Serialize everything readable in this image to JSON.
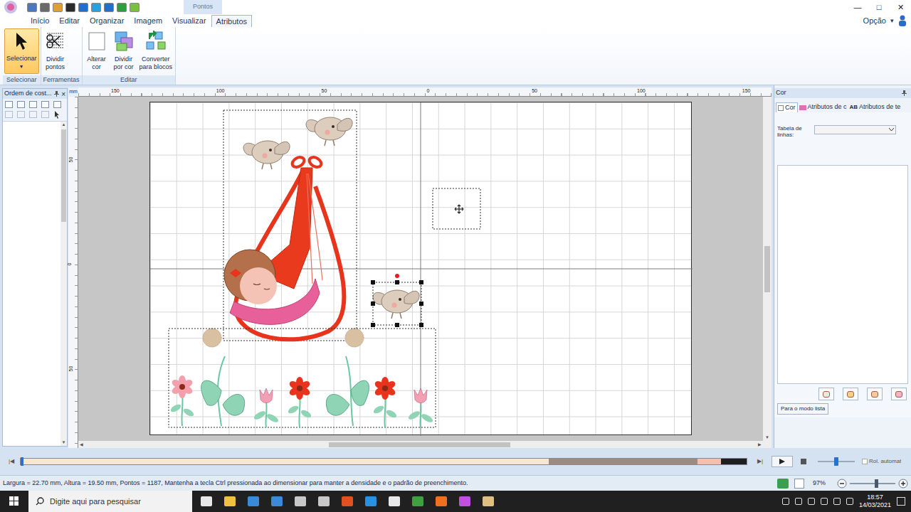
{
  "app": {
    "context_tab": "Pontos",
    "window_controls": [
      "—",
      "□",
      "✕"
    ]
  },
  "ribbon": {
    "tabs": [
      {
        "label": "Início",
        "selected": false
      },
      {
        "label": "Editar",
        "selected": false
      },
      {
        "label": "Organizar",
        "selected": false
      },
      {
        "label": "Imagem",
        "selected": false
      },
      {
        "label": "Visualizar",
        "selected": false
      },
      {
        "label": "Atributos",
        "selected": true
      }
    ],
    "option": {
      "label": "Opção",
      "arrow": "▾"
    },
    "groups": [
      {
        "label": "Selecionar",
        "buttons": [
          {
            "lines": [
              "Selecionar"
            ],
            "selected": true,
            "dropdown": "▾",
            "icon": "arrow"
          }
        ]
      },
      {
        "label": "Ferramentas",
        "buttons": [
          {
            "lines": [
              "Dividir",
              "pontos"
            ],
            "selected": false,
            "dropdown": "",
            "icon": "split"
          }
        ]
      },
      {
        "label": "Editar",
        "buttons": [
          {
            "lines": [
              "Alterar",
              "cor"
            ],
            "selected": false,
            "dropdown": "",
            "icon": "color"
          },
          {
            "lines": [
              "Dividir",
              "por cor"
            ],
            "selected": false,
            "dropdown": "",
            "icon": "bycolor"
          },
          {
            "lines": [
              "Converter",
              "para blocos"
            ],
            "selected": false,
            "dropdown": "",
            "icon": "convert"
          }
        ]
      }
    ]
  },
  "left_panel": {
    "title": "Ordem de cost...",
    "close": "×"
  },
  "canvas": {
    "unit": "mm",
    "ruler_top": [
      "150",
      "100",
      "50",
      "0",
      "50",
      "100",
      "150"
    ],
    "ruler_left": [
      "50",
      "0",
      "50"
    ]
  },
  "color_panel": {
    "title": "Cor",
    "tabs": [
      {
        "label": "Cor",
        "selected": true,
        "icon_text": ""
      },
      {
        "label": "Atributos de c",
        "selected": false,
        "icon_text": ""
      },
      {
        "label": "Atributos de te",
        "selected": false,
        "icon_text": "AB"
      }
    ],
    "thread_table_label": [
      "Tabela de",
      "linhas:"
    ],
    "thread_table_value": "",
    "list_mode_button": "Para o modo lista"
  },
  "simulator": {
    "progress": 0.0,
    "segments": [
      {
        "color": "#f6e6d2",
        "share": 0.727
      },
      {
        "color": "#9c8c7f",
        "share": 0.205
      },
      {
        "color": "#f3bfae",
        "share": 0.033
      },
      {
        "color": "#1e1e1e",
        "share": 0.035
      }
    ],
    "speed": {
      "level": 0.5
    },
    "auto_scroll": {
      "label": "Rol. automat",
      "checked": false
    }
  },
  "status_bar": {
    "text": "Largura = 22.70 mm, Altura = 19.50 mm, Pontos = 1187, Mantenha a tecla Ctrl pressionada ao dimensionar para manter a densidade e o padrão de preenchimento.",
    "zoom": "97%",
    "zoom_level": 0.55
  },
  "taskbar": {
    "search_placeholder": "Digite aqui para pesquisar",
    "time": "18:57",
    "date": "14/03/2021"
  }
}
